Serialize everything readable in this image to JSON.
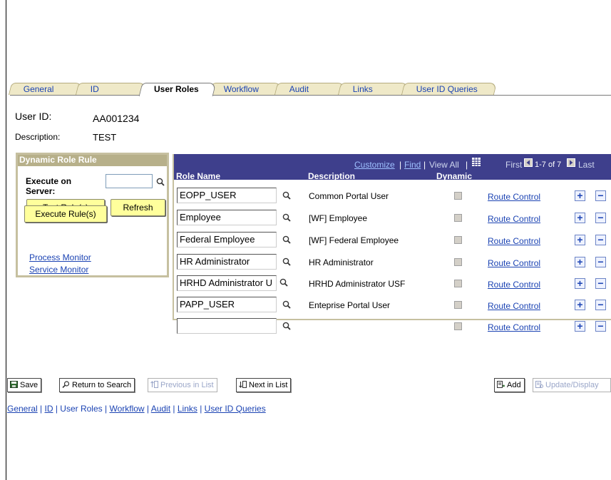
{
  "tabs": [
    "General",
    "ID",
    "User Roles",
    "Workflow",
    "Audit",
    "Links",
    "User ID Queries"
  ],
  "active_tab": "User Roles",
  "header": {
    "user_id_label": "User ID:",
    "user_id_value": "AA001234",
    "description_label": "Description:",
    "description_value": "TEST"
  },
  "dynamic_role_rule": {
    "title": "Dynamic Role Rule",
    "execute_label": "Execute on Server:",
    "execute_value": "",
    "test_rule_button": "Test Rule(s)",
    "refresh_button": "Refresh",
    "execute_rule_button": "Execute Rule(s)",
    "process_monitor_link": "Process Monitor",
    "service_monitor_link": "Service Monitor"
  },
  "grid": {
    "customize": "Customize",
    "find": "Find",
    "view_all": "View All",
    "first": "First",
    "range": "1-7 of 7",
    "last": "Last",
    "columns": [
      "Role Name",
      "Description",
      "Dynamic"
    ],
    "rows": [
      {
        "role": "EOPP_USER",
        "description": "Common Portal User",
        "route": "Route Control"
      },
      {
        "role": "Employee",
        "description": "[WF] Employee",
        "route": "Route Control"
      },
      {
        "role": "Federal Employee",
        "description": "[WF] Federal Employee",
        "route": "Route Control"
      },
      {
        "role": "HR Administrator",
        "description": "HR Administrator",
        "route": "Route Control"
      },
      {
        "role": "HRHD Administrator U",
        "description": "HRHD Administrator USF",
        "route": "Route Control"
      },
      {
        "role": "PAPP_USER",
        "description": "Enteprise Portal User",
        "route": "Route Control"
      },
      {
        "role": "",
        "description": "",
        "route": "Route Control"
      }
    ]
  },
  "toolbar": {
    "save": "Save",
    "return_to_search": "Return to Search",
    "previous_in_list": "Previous in List",
    "next_in_list": "Next in List",
    "add": "Add",
    "update_display": "Update/Display"
  },
  "footer_links": [
    "General",
    "ID",
    "User Roles",
    "Workflow",
    "Audit",
    "Links",
    "User ID Queries"
  ],
  "colors": {
    "grid_header": "#3e3f8c",
    "box_header": "#b7b08a",
    "link": "#1b43b3",
    "button_yellow": "#ffff9c",
    "tab_inactive": "#efe9c8"
  }
}
